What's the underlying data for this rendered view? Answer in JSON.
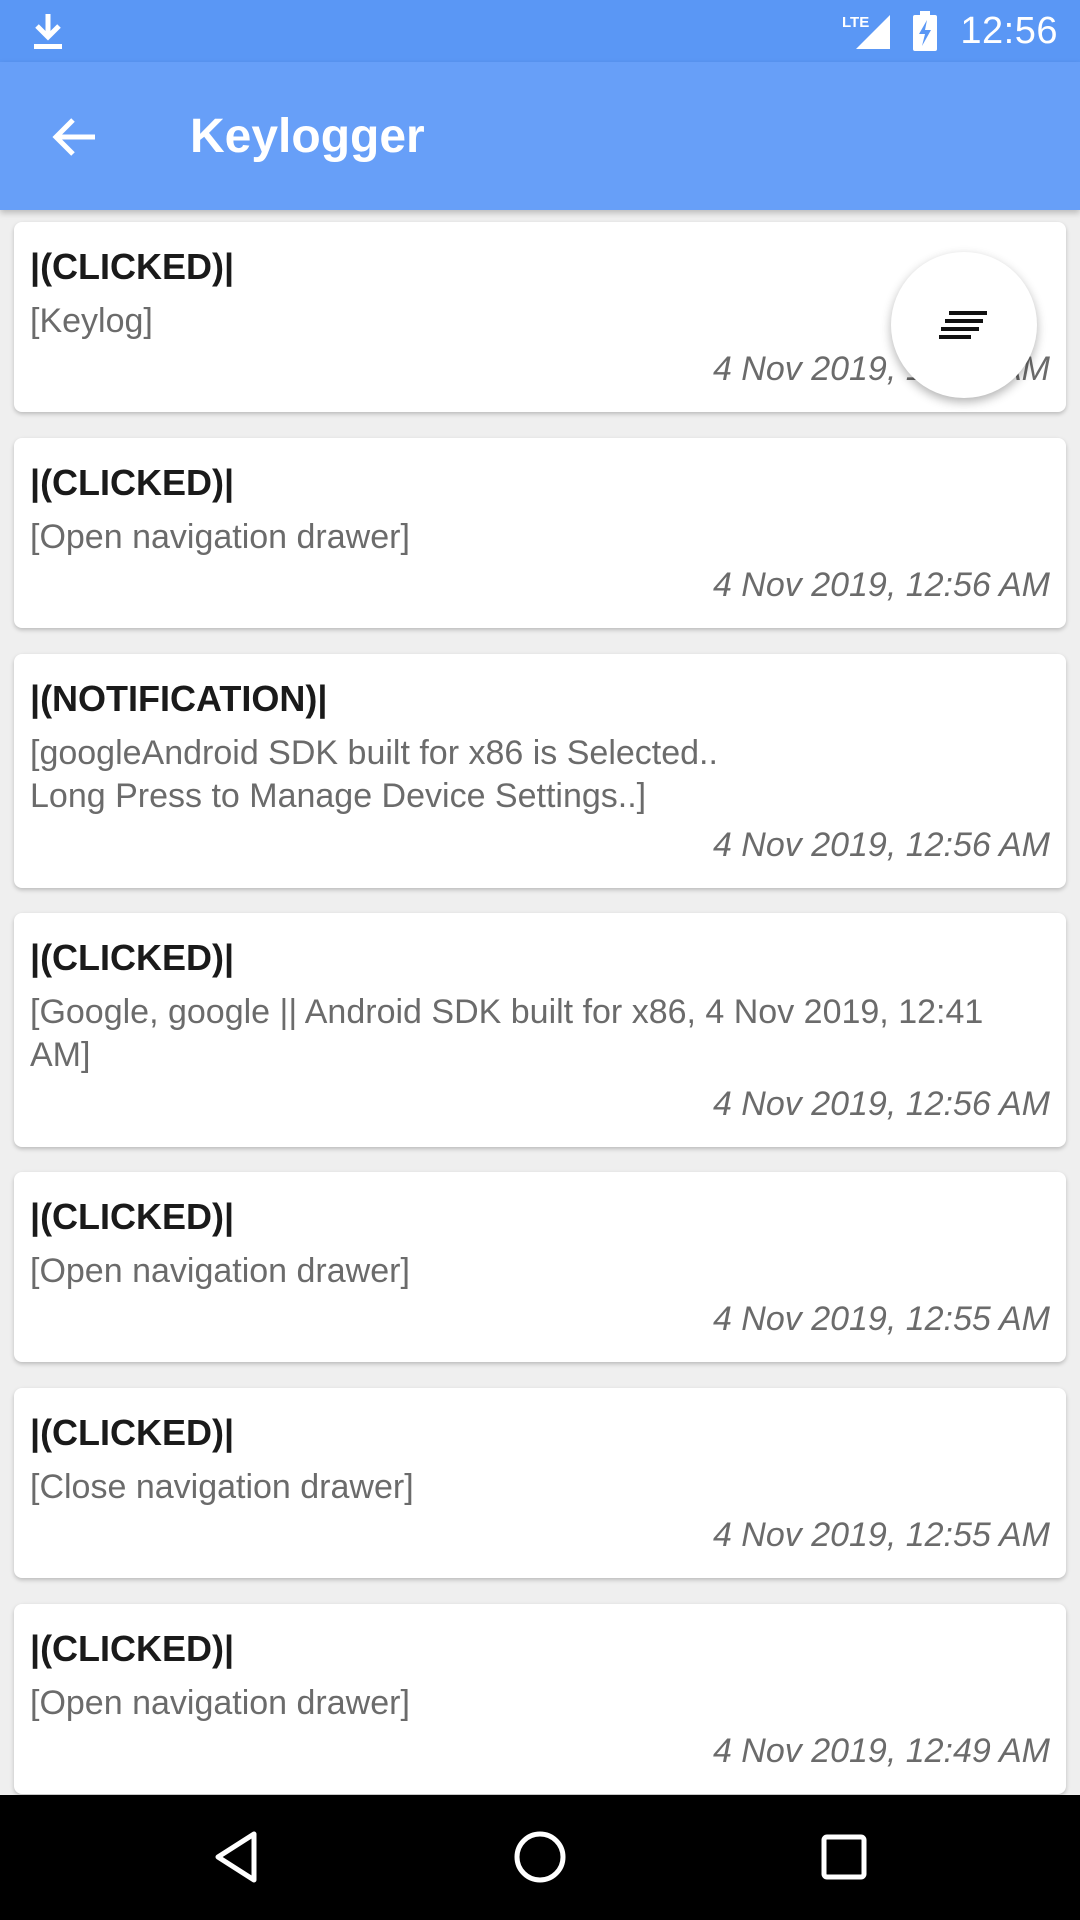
{
  "status_bar": {
    "network": "LTE",
    "time": "12:56",
    "icons": [
      "download-icon",
      "lte-signal-icon",
      "battery-charging-icon"
    ]
  },
  "app_bar": {
    "title": "Keylogger",
    "back_icon": "arrow-back-icon"
  },
  "fab": {
    "icon": "sort-icon"
  },
  "logs": [
    {
      "type": "|(CLICKED)|",
      "text": "[Keylog]",
      "time": "4 Nov 2019, 12:56 AM"
    },
    {
      "type": "|(CLICKED)|",
      "text": "[Open navigation drawer]",
      "time": "4 Nov 2019, 12:56 AM"
    },
    {
      "type": "|(NOTIFICATION)|",
      "text": "[googleAndroid SDK built for x86 is Selected..\nLong Press to Manage Device Settings..]",
      "time": "4 Nov 2019, 12:56 AM"
    },
    {
      "type": "|(CLICKED)|",
      "text": "[Google, google || Android SDK built for x86, 4 Nov 2019, 12:41 AM]",
      "time": "4 Nov 2019, 12:56 AM"
    },
    {
      "type": "|(CLICKED)|",
      "text": "[Open navigation drawer]",
      "time": "4 Nov 2019, 12:55 AM"
    },
    {
      "type": "|(CLICKED)|",
      "text": "[Close navigation drawer]",
      "time": "4 Nov 2019, 12:55 AM"
    },
    {
      "type": "|(CLICKED)|",
      "text": "[Open navigation drawer]",
      "time": "4 Nov 2019, 12:49 AM"
    }
  ],
  "nav_bar": {
    "icons": [
      "back-triangle-icon",
      "home-circle-icon",
      "recents-square-icon"
    ]
  }
}
